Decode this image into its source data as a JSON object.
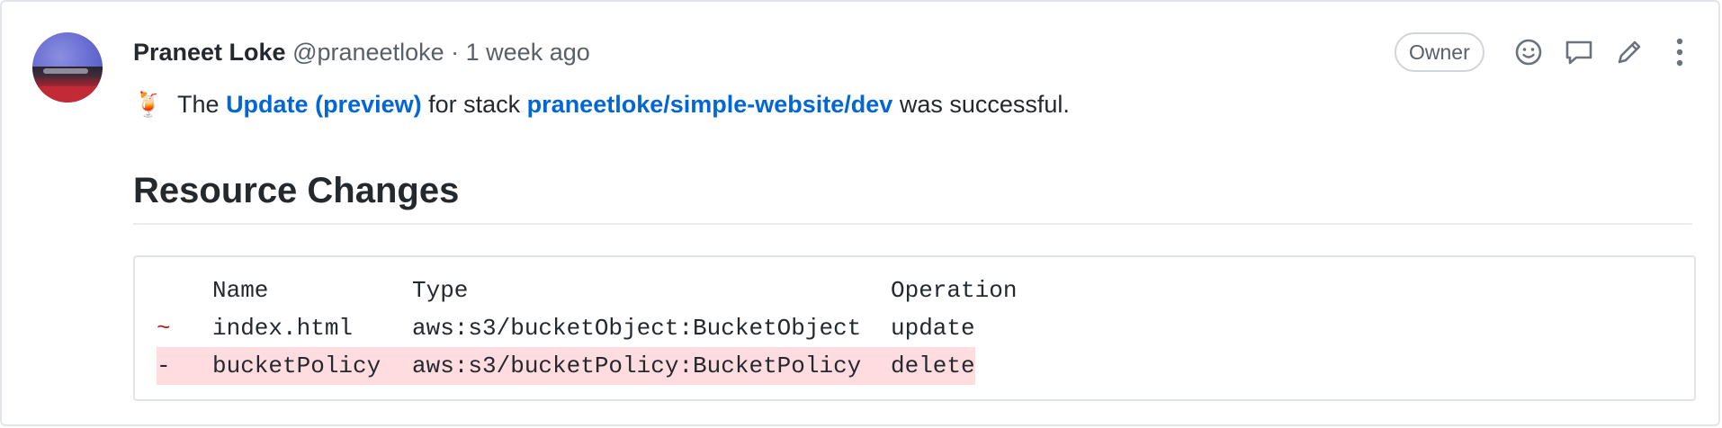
{
  "comment": {
    "author_name": "Praneet Loke",
    "author_handle": "@praneetloke",
    "separator": "·",
    "timestamp": "1 week ago",
    "role_badge": "Owner",
    "actions": [
      {
        "name": "add-reaction",
        "icon": "smiley-icon"
      },
      {
        "name": "reply",
        "icon": "comment-icon"
      },
      {
        "name": "edit",
        "icon": "pencil-icon"
      },
      {
        "name": "more",
        "icon": "kebab-icon"
      }
    ]
  },
  "message": {
    "emoji": "🍹",
    "text_1": "The",
    "link_update": "Update (preview)",
    "text_2": "for stack",
    "link_stack": "praneetloke/simple-website/dev",
    "text_3": "was successful."
  },
  "section": {
    "title": "Resource Changes"
  },
  "table": {
    "headers": {
      "name": "Name",
      "type": "Type",
      "operation": "Operation"
    },
    "rows": [
      {
        "marker": "~",
        "name": "index.html",
        "type": "aws:s3/bucketObject:BucketObject",
        "operation": "update",
        "kind": "modified"
      },
      {
        "marker": "-",
        "name": "bucketPolicy",
        "type": "aws:s3/bucketPolicy:BucketPolicy",
        "operation": "delete",
        "kind": "deleted"
      }
    ]
  },
  "colors": {
    "link": "#0366d6",
    "deleted_row_bg": "#ffdce0",
    "modified_marker": "#b31d28",
    "muted_text": "#586069"
  }
}
